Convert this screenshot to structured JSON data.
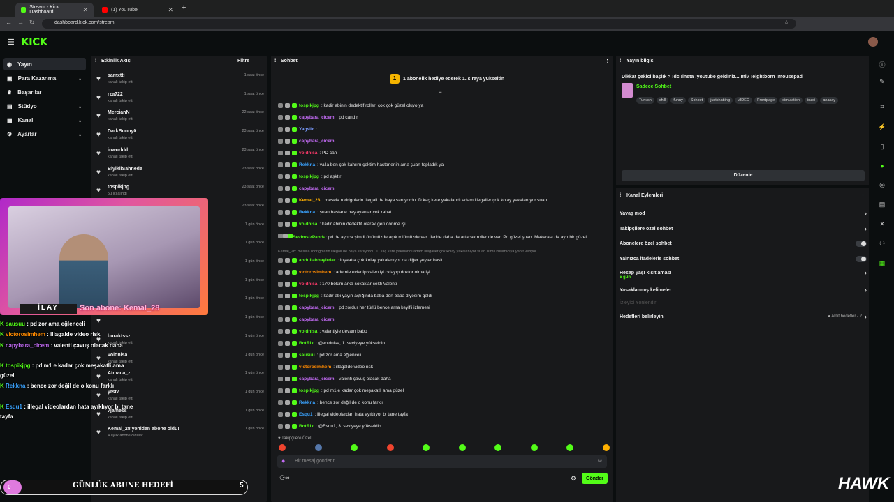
{
  "browser": {
    "tabs": [
      {
        "label": "Stream - Kick Dashboard"
      },
      {
        "label": "(1) YouTube"
      }
    ],
    "url": "dashboard.kick.com/stream"
  },
  "brand": {
    "logo": "KICK",
    "accent": "#53fc18"
  },
  "sidebar": {
    "items": [
      {
        "label": "Yayın",
        "icon": "broadcast-icon"
      },
      {
        "label": "Para Kazanma",
        "icon": "money-icon"
      },
      {
        "label": "Başarılar",
        "icon": "trophy-icon"
      },
      {
        "label": "Stüdyo",
        "icon": "studio-icon"
      },
      {
        "label": "Kanal",
        "icon": "channel-icon"
      },
      {
        "label": "Ayarlar",
        "icon": "settings-icon"
      }
    ]
  },
  "activity": {
    "title": "Etkinlik Akışı",
    "filter": "Filtre",
    "items": [
      {
        "name": "samxtti",
        "action": "kanalı takip etti",
        "time": "1 saat önce"
      },
      {
        "name": "rza722",
        "action": "kanalı takip etti",
        "time": "1 saat önce"
      },
      {
        "name": "MercianN",
        "action": "kanalı takip etti",
        "time": "22 saat önce"
      },
      {
        "name": "DarkBunny0",
        "action": "kanalı takip etti",
        "time": "23 saat önce"
      },
      {
        "name": "inworldd",
        "action": "kanalı takip etti",
        "time": "23 saat önce"
      },
      {
        "name": "BiyikliSahnede",
        "action": "kanalı takip etti",
        "time": "23 saat önce"
      },
      {
        "name": "tospikjpg",
        "action": "5u içi alındı",
        "time": "23 saat önce"
      },
      {
        "name": "",
        "action": "",
        "time": "23 saat önce"
      },
      {
        "name": "",
        "action": "",
        "time": "1 gün önce"
      },
      {
        "name": "",
        "action": "",
        "time": "1 gün önce"
      },
      {
        "name": "",
        "action": "",
        "time": "1 gün önce"
      },
      {
        "name": "",
        "action": "",
        "time": "1 gün önce"
      },
      {
        "name": "",
        "action": "",
        "time": "1 gün önce"
      },
      {
        "name": "",
        "action": "",
        "time": "1 gün önce"
      },
      {
        "name": "buraktssz",
        "action": "kanalı takip etti",
        "time": "1 gün önce"
      },
      {
        "name": "voidnisa",
        "action": "kanalı takip etti",
        "time": "1 gün önce"
      },
      {
        "name": "Atmaca_z",
        "action": "kanalı takip etti",
        "time": "1 gün önce"
      },
      {
        "name": "yrst7",
        "action": "kanalı takip etti",
        "time": "1 gün önce"
      },
      {
        "name": "7jamess",
        "action": "kanalı takip etti",
        "time": "1 gün önce"
      },
      {
        "name": "Kemal_28 yeniden abone oldu!",
        "action": "4 aylık abone oldular",
        "time": "1 gün önce"
      }
    ]
  },
  "chat": {
    "title": "Sohbet",
    "pinned": "1 abonelik hediye ederek 1. sıraya yükseltin",
    "followers_only": "Takipçilere Özel",
    "input_placeholder": "Bir mesaj gönderin",
    "send": "Gönder",
    "lines": [
      {
        "user": "tospikjpg",
        "color": "#53fc18",
        "text": ": kadir abinin dedektif rolleri çok çok güzel oluyo ya"
      },
      {
        "user": "capybara_cicem",
        "color": "#c46cf6",
        "text": ": pd candır"
      },
      {
        "user": "Yagslir",
        "color": "#7b9cff",
        "text": ":"
      },
      {
        "user": "capybara_cicem",
        "color": "#c46cf6",
        "text": ":"
      },
      {
        "user": "voidnisa",
        "color": "#ff3a6b",
        "text": ": PD can"
      },
      {
        "user": "Rekkna",
        "color": "#3aa3ff",
        "text": ": valla ben çok kahrını çektim hastanenin ama şuan topladık ya"
      },
      {
        "user": "tospikjpg",
        "color": "#53fc18",
        "text": ": pd aşktır"
      },
      {
        "user": "capybara_cicem",
        "color": "#c46cf6",
        "text": ":"
      },
      {
        "user": "Kemal_28",
        "color": "#ffb000",
        "text": ": mesela rodrigolarin illegali de baya sarılyordu :D kaç kere yakalandı adam illegaller çok kolay yakalanıyor suan"
      },
      {
        "user": "Rekkna",
        "color": "#3aa3ff",
        "text": ": şuan hastane başlayanlar çok rahat"
      },
      {
        "user": "voidnisa",
        "color": "#53fc18",
        "text": ": kadir abinin dedektif olarak geri dönme işi"
      },
      {
        "user": "SevimsizPanda",
        "color": "#53fc18",
        "text": ": pd de ayrıca şimdi önümüzde açık rolümüzde var. İleride daha da artacak roller de var. Pd güzel şuan. Makarası da ayrı bir güzel."
      },
      {
        "user": "",
        "color": "#888",
        "text": "Kemal_28: mesela rodrigolarin illegali de baya sarılyordu :D kaç kere yakalandı adam illegaller çok kolay yakalanıyor suan isimli kullanıcıya yanıt veriyor"
      },
      {
        "user": "abdullahbayirdar",
        "color": "#53fc18",
        "text": ": inşaatta çok kolay yakalanıyor da diğer şeyler basit"
      },
      {
        "user": "victorosimhem",
        "color": "#ff8a00",
        "text": ": ademle evlenip valentiyi cklayıp doktor olma işi"
      },
      {
        "user": "voidnisa",
        "color": "#ff3a6b",
        "text": ": 170 bölüm arka sokaklar çekti Valenti"
      },
      {
        "user": "tospikjpg",
        "color": "#53fc18",
        "text": ": kadir abi yayın açtığında baba dön baba diyesim geldi"
      },
      {
        "user": "capybara_cicem",
        "color": "#c46cf6",
        "text": ": pd zordur her türlü bence ama keyifli izlemesi"
      },
      {
        "user": "capybara_cicem",
        "color": "#c46cf6",
        "text": ":"
      },
      {
        "user": "voidnisa",
        "color": "#53fc18",
        "text": ": valentiyle devam babo"
      },
      {
        "user": "BotRix",
        "color": "#53fc18",
        "text": ": @voidnisa, 1. seviyeye yükseldin"
      },
      {
        "user": "sausuu",
        "color": "#53fc18",
        "text": ": pd zor ama eğlenceli"
      },
      {
        "user": "victorosimhem",
        "color": "#ff8a00",
        "text": ": illagalde video risk"
      },
      {
        "user": "capybara_cicem",
        "color": "#c46cf6",
        "text": ": valenti çavuş olacak daha"
      },
      {
        "user": "tospikjpg",
        "color": "#53fc18",
        "text": ": pd m1 e kadar çok meşakatli ama güzel"
      },
      {
        "user": "Rekkna",
        "color": "#3aa3ff",
        "text": ": bence zor değil de o konu farklı"
      },
      {
        "user": "Esqu1",
        "color": "#3aa3ff",
        "text": ": illegal videolardan hata ayıklıyor bi tane tayfa"
      },
      {
        "user": "BotRix",
        "color": "#53fc18",
        "text": ": @Esqu1, 3. seviyeye yükseldin"
      }
    ]
  },
  "stream_info": {
    "title": "Yayın bilgisi",
    "stream_title": "Dikkat çekici başlık > !dc !insta !youtube geldiniz... mi? !eightborn !mousepad",
    "category": "Sadece Sohbet",
    "tags": [
      "Turkish",
      "chill",
      "funny",
      "Sohbet",
      "justchatting",
      "VIDEO",
      "Frontpage",
      "simulation",
      "inzoi",
      "anasay"
    ],
    "edit": "Düzenle"
  },
  "channel_actions": {
    "title": "Kanal Eylemleri",
    "rows": [
      {
        "label": "Yavaş mod",
        "kind": "arrow"
      },
      {
        "label": "Takipçilere özel sohbet",
        "kind": "arrow"
      },
      {
        "label": "Abonelere özel sohbet",
        "kind": "toggle"
      },
      {
        "label": "Yalnızca ifadelerle sohbet",
        "kind": "toggle"
      },
      {
        "label": "Hesap yaşı kısıtlaması",
        "sub": "5 gün",
        "kind": "arrow"
      },
      {
        "label": "Yasaklanmış kelimeler",
        "kind": "arrow"
      },
      {
        "label": "İzleyici Yönlendir",
        "kind": "disabled"
      },
      {
        "label": "Hedefleri belirleyin",
        "kind": "goal",
        "status": "Aktif hedefler - 2"
      }
    ]
  },
  "overlay": {
    "cam_name": "İLAY",
    "last_sub": "Son abone: Kemal_28",
    "goal_label": "GÜNLÜK ABUNE HEDEFİ",
    "goal_left": "0",
    "goal_right": "5",
    "watermark": "HAWK",
    "chat": [
      {
        "user": "sausuu",
        "color": "#53fc18",
        "text": " : pd zor ama eğlenceli"
      },
      {
        "user": "victorosimhem",
        "color": "#ff8a00",
        "text": " : illagalde video risk"
      },
      {
        "user": "capybara_cicem",
        "color": "#c46cf6",
        "text": " : valenti çavuş olacak daha"
      },
      {
        "user": "tospikjpg",
        "color": "#53fc18",
        "text": " : pd m1 e kadar çok meşakatli ama güzel"
      },
      {
        "user": "Rekkna",
        "color": "#3aa3ff",
        "text": " : bence zor değil de o konu farklı"
      },
      {
        "user": "Esqu1",
        "color": "#3aa3ff",
        "text": " : illegal videolardan hata ayıklıyor bi tane tayfa"
      }
    ]
  }
}
